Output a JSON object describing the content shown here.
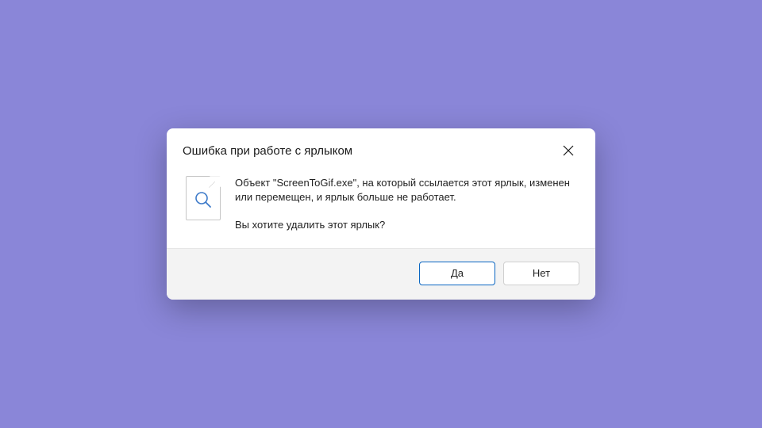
{
  "dialog": {
    "title": "Ошибка при работе с ярлыком",
    "message": "Объект \"ScreenToGif.exe\", на который ссылается этот ярлык, изменен или перемещен, и ярлык больше не работает.",
    "question": "Вы хотите удалить этот ярлык?",
    "buttons": {
      "yes": "Да",
      "no": "Нет"
    }
  }
}
